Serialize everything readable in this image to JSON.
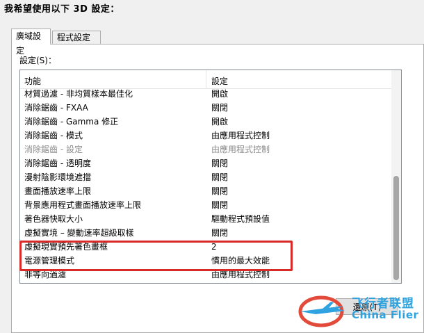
{
  "heading": "我希望使用以下 3D 設定：",
  "tabs": [
    {
      "label": "廣域設定",
      "active": true
    },
    {
      "label": "程式設定",
      "active": false
    }
  ],
  "settings_label": "設定(S)：",
  "table": {
    "headers": [
      "功能",
      "設定"
    ],
    "rows": [
      {
        "feature": "材質過濾 - 非均質樣本最佳化",
        "value": "開啟",
        "dim": false
      },
      {
        "feature": "消除鋸齒 - FXAA",
        "value": "關閉",
        "dim": false
      },
      {
        "feature": "消除鋸齒 - Gamma 修正",
        "value": "開啟",
        "dim": false
      },
      {
        "feature": "消除鋸齒 - 模式",
        "value": "由應用程式控制",
        "dim": false
      },
      {
        "feature": "消除鋸齒 - 設定",
        "value": "由應用程式控制",
        "dim": true
      },
      {
        "feature": "消除鋸齒 - 透明度",
        "value": "關閉",
        "dim": false
      },
      {
        "feature": "漫射陰影環境遮擋",
        "value": "關閉",
        "dim": false
      },
      {
        "feature": "畫面播放速率上限",
        "value": "關閉",
        "dim": false
      },
      {
        "feature": "背景應用程式畫面播放速率上限",
        "value": "關閉",
        "dim": false
      },
      {
        "feature": "著色器快取大小",
        "value": "驅動程式預設值",
        "dim": false
      },
      {
        "feature": "虛擬實境 – 變動速率超級取樣",
        "value": "關閉",
        "dim": false
      },
      {
        "feature": "虛擬現實預先著色畫框",
        "value": "2",
        "dim": false
      },
      {
        "feature": "電源管理模式",
        "value": "慣用的最大效能",
        "dim": false
      },
      {
        "feature": "非等向過濾",
        "value": "由應用程式控制",
        "dim": false
      }
    ]
  },
  "restore_button": "還原(T)",
  "watermark": {
    "cn": "飞行者联盟",
    "en": "China Flier"
  },
  "colors": {
    "highlight": "#d92a2a",
    "watermark": "#2fa3df"
  }
}
